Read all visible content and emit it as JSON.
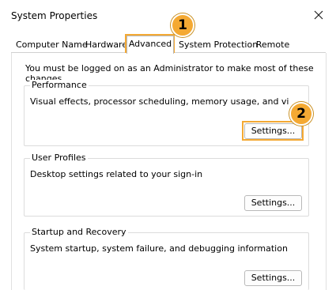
{
  "window": {
    "title": "System Properties",
    "close_icon": "close-icon"
  },
  "tabs": [
    {
      "label": "Computer Name",
      "active": false
    },
    {
      "label": "Hardware",
      "active": false
    },
    {
      "label": "Advanced",
      "active": true
    },
    {
      "label": "System Protection",
      "active": false
    },
    {
      "label": "Remote",
      "active": false
    }
  ],
  "notice": "You must be logged on as an Administrator to make most of these changes.",
  "groups": {
    "performance": {
      "label": "Performance",
      "description": "Visual effects, processor scheduling, memory usage, and virtual memory",
      "button": "Settings..."
    },
    "user_profiles": {
      "label": "User Profiles",
      "description": "Desktop settings related to your sign-in",
      "button": "Settings..."
    },
    "startup_recovery": {
      "label": "Startup and Recovery",
      "description": "System startup, system failure, and debugging information",
      "button": "Settings..."
    }
  },
  "annotations": {
    "marker_1": "1",
    "marker_2": "2",
    "highlight_color": "#f4a933"
  }
}
